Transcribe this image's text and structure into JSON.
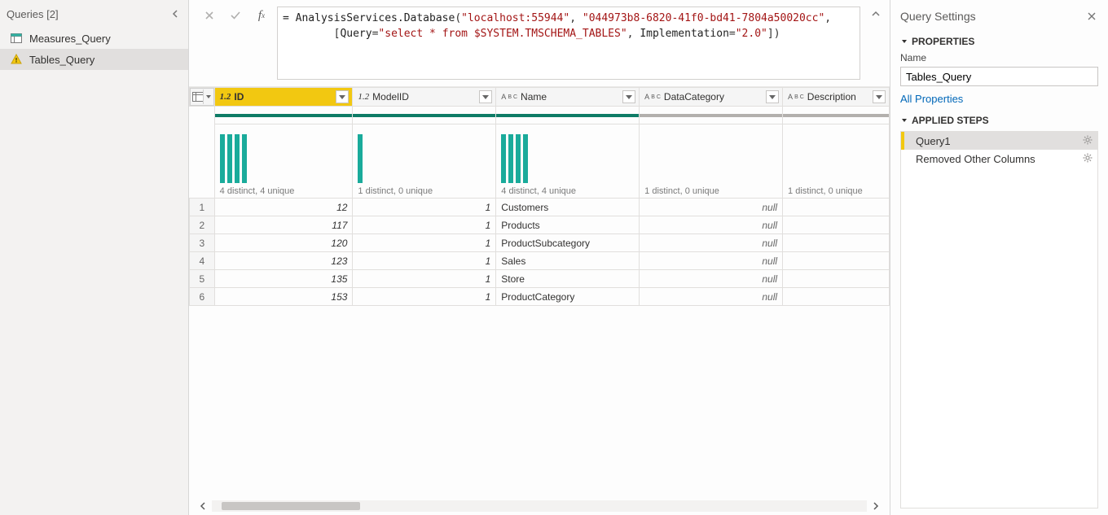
{
  "sidebar": {
    "title": "Queries [2]",
    "items": [
      {
        "label": "Measures_Query",
        "icon": "table",
        "selected": false,
        "warn": false
      },
      {
        "label": "Tables_Query",
        "icon": "warn",
        "selected": true,
        "warn": true
      }
    ]
  },
  "formula": {
    "prefix": "= ",
    "func": "AnalysisServices.Database",
    "open": "(",
    "arg1": "\"localhost:55944\"",
    "sep1": ", ",
    "arg2": "\"044973b8-6820-41f0-bd41-7804a50020cc\"",
    "sep2": ",",
    "line2_indent": "        [",
    "p1k": "Query",
    "p1e": "=",
    "p1v": "\"select * from $SYSTEM.TMSCHEMA_TABLES\"",
    "p_sep": ", ",
    "p2k": "Implementation",
    "p2e": "=",
    "p2v": "\"2.0\"",
    "close": "])"
  },
  "table": {
    "columns": [
      {
        "key": "ID",
        "label": "ID",
        "dtype": "1.2",
        "selected": true,
        "profile": "4 distinct, 4 unique",
        "bars": [
          60,
          60,
          60,
          60
        ],
        "gray": false
      },
      {
        "key": "ModelID",
        "label": "ModelID",
        "dtype": "1.2",
        "selected": false,
        "profile": "1 distinct, 0 unique",
        "bars": [
          60
        ],
        "gray": false
      },
      {
        "key": "Name",
        "label": "Name",
        "dtype": "ABC",
        "selected": false,
        "profile": "4 distinct, 4 unique",
        "bars": [
          60,
          60,
          60,
          60
        ],
        "gray": false
      },
      {
        "key": "DataCategory",
        "label": "DataCategory",
        "dtype": "ABC",
        "selected": false,
        "profile": "1 distinct, 0 unique",
        "bars": [],
        "gray": true
      },
      {
        "key": "Description",
        "label": "Description",
        "dtype": "ABC",
        "selected": false,
        "profile": "1 distinct, 0 unique",
        "bars": [],
        "gray": true
      }
    ],
    "rows": [
      {
        "n": "1",
        "ID": "12",
        "ModelID": "1",
        "Name": "Customers",
        "DataCategory": "null",
        "Description": ""
      },
      {
        "n": "2",
        "ID": "117",
        "ModelID": "1",
        "Name": "Products",
        "DataCategory": "null",
        "Description": ""
      },
      {
        "n": "3",
        "ID": "120",
        "ModelID": "1",
        "Name": "ProductSubcategory",
        "DataCategory": "null",
        "Description": ""
      },
      {
        "n": "4",
        "ID": "123",
        "ModelID": "1",
        "Name": "Sales",
        "DataCategory": "null",
        "Description": ""
      },
      {
        "n": "5",
        "ID": "135",
        "ModelID": "1",
        "Name": "Store",
        "DataCategory": "null",
        "Description": ""
      },
      {
        "n": "6",
        "ID": "153",
        "ModelID": "1",
        "Name": "ProductCategory",
        "DataCategory": "null",
        "Description": ""
      }
    ]
  },
  "settings": {
    "panel_title": "Query Settings",
    "properties_title": "PROPERTIES",
    "name_label": "Name",
    "name_value": "Tables_Query",
    "all_props": "All Properties",
    "steps_title": "APPLIED STEPS",
    "steps": [
      {
        "label": "Query1",
        "selected": true,
        "gear": true
      },
      {
        "label": "Removed Other Columns",
        "selected": false,
        "gear": true
      }
    ]
  }
}
